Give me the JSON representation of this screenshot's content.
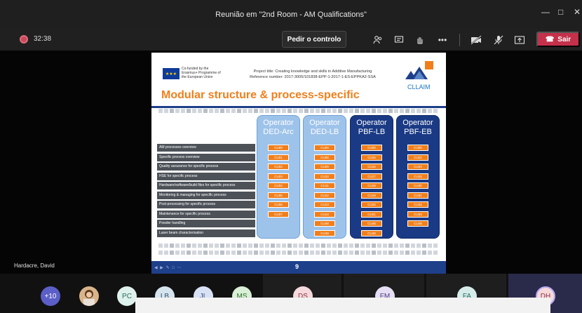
{
  "window": {
    "title": "Reunião em \"2nd Room - AM Qualifications\""
  },
  "toolbar": {
    "timer": "32:38",
    "control_label": "Pedir o controlo",
    "leave_label": "Sair"
  },
  "presenter": {
    "name": "Hardacre, David"
  },
  "slide": {
    "cofund": "Co-funded by the Erasmus+ Programme of the European Union",
    "project_line": "Project title: Creating knowledge and skills in Additive Manufacturing",
    "reference_line": "Reference number: 2017-3005/101838-EPP-1-2017-1-ES-EPPKA2-SSA",
    "brand": "CLLAIM",
    "title": "Modular structure & process-specific",
    "page": "9",
    "columns": [
      {
        "line1": "Operator",
        "line2": "DED-Arc"
      },
      {
        "line1": "Operator",
        "line2": "DED-LB"
      },
      {
        "line1": "Operator",
        "line2": "PBF-LB"
      },
      {
        "line1": "Operator",
        "line2": "PBF-EB"
      }
    ],
    "rows": [
      "AM processes overview",
      "Specific process overview",
      "Quality assurance for specific process",
      "HSE for specific process",
      "Hardware/software/build files for specific process",
      "Monitoring & managing for specific process",
      "Post-processing for specific process",
      "Maintenance for specific process",
      "Powder handling",
      "Laser beam characterisation"
    ],
    "cu_col1": [
      "CU00",
      "CU01",
      "CU02",
      "CU03",
      "CU04",
      "CU05",
      "CU06",
      "CU07"
    ],
    "cu_col2": [
      "CU00",
      "CU08",
      "CU09",
      "CU10",
      "CU11",
      "CU12",
      "CU13",
      "CU14",
      "CU48",
      "CU49"
    ],
    "cu_col3": [
      "CU00",
      "CU15",
      "CU16",
      "CU17",
      "CU18",
      "CU19",
      "CU20",
      "CU21",
      "CU48",
      "CU49"
    ],
    "cu_col4": [
      "CU00",
      "CU22",
      "CU23",
      "CU24",
      "CU30",
      "CU31",
      "CU32",
      "CU33",
      "CU48"
    ]
  },
  "participants": {
    "overflow": "+10",
    "initials": [
      "PC",
      "LB",
      "JL",
      "MS",
      "DS",
      "FM",
      "FA",
      "DH"
    ]
  },
  "colors": {
    "accent_orange": "#f07f1b",
    "slide_blue": "#1e3f8a",
    "leave_red": "#c4314b"
  }
}
